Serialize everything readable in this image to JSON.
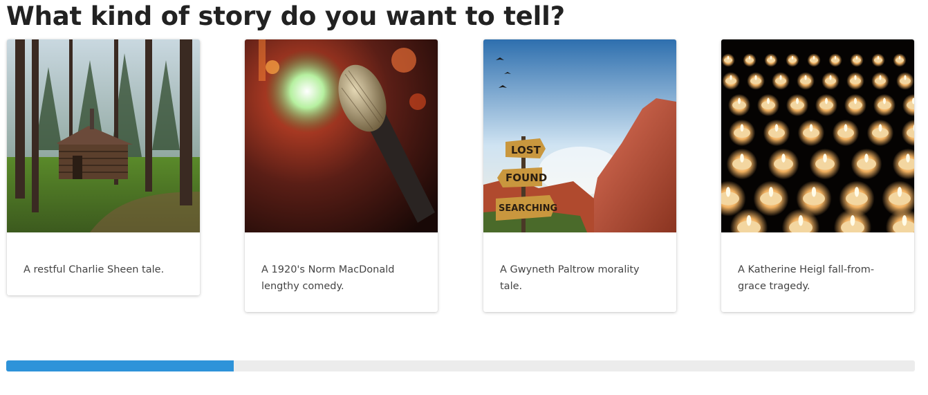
{
  "page": {
    "title": "What kind of story do you want to tell?"
  },
  "cards": [
    {
      "image": "forest-cabin-image",
      "caption": "A restful Charlie Sheen tale."
    },
    {
      "image": "microphone-stage-image",
      "caption": "A 1920's Norm MacDonald lengthy comedy."
    },
    {
      "image": "lost-found-searching-sign-image",
      "caption": "A Gwyneth Paltrow morality tale.",
      "sign_words": [
        "LOST",
        "FOUND",
        "SEARCHING"
      ]
    },
    {
      "image": "candles-image",
      "caption": "A Katherine Heigl fall-from-grace tragedy."
    }
  ],
  "progress": {
    "value_fraction": 0.25,
    "fill_color": "#2e93d9",
    "track_color": "#ececec"
  }
}
